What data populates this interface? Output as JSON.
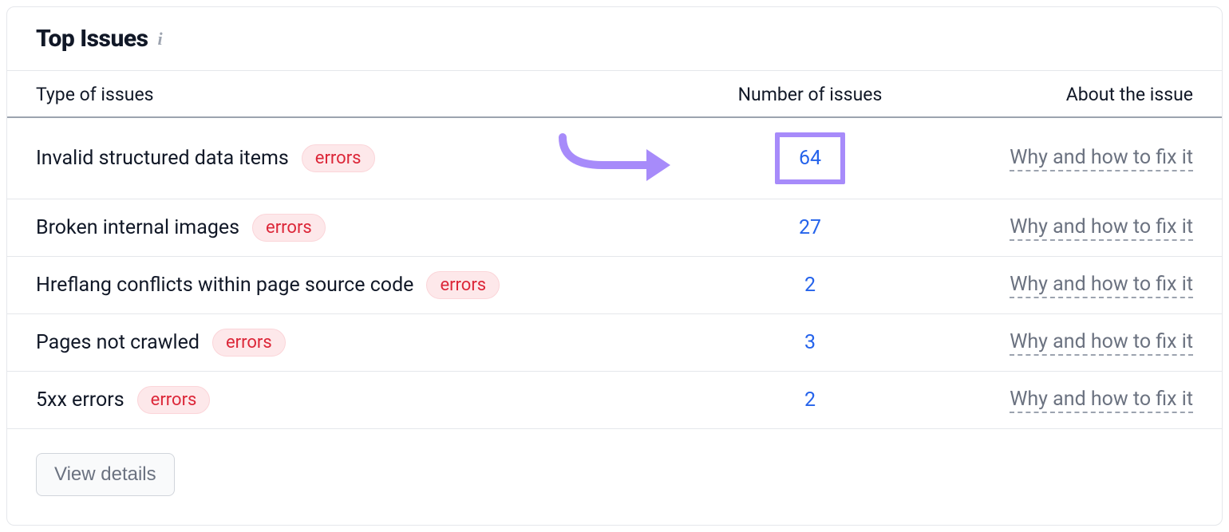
{
  "header": {
    "title": "Top Issues"
  },
  "columns": {
    "type": "Type of issues",
    "number": "Number of issues",
    "about": "About the issue"
  },
  "badge_label": "errors",
  "about_link_text": "Why and how to fix it",
  "footer": {
    "view_details": "View details"
  },
  "issues": [
    {
      "name": "Invalid structured data items",
      "count": 64,
      "highlighted": true
    },
    {
      "name": "Broken internal images",
      "count": 27,
      "highlighted": false
    },
    {
      "name": "Hreflang conflicts within page source code",
      "count": 2,
      "highlighted": false
    },
    {
      "name": "Pages not crawled",
      "count": 3,
      "highlighted": false
    },
    {
      "name": "5xx errors",
      "count": 2,
      "highlighted": false
    }
  ]
}
